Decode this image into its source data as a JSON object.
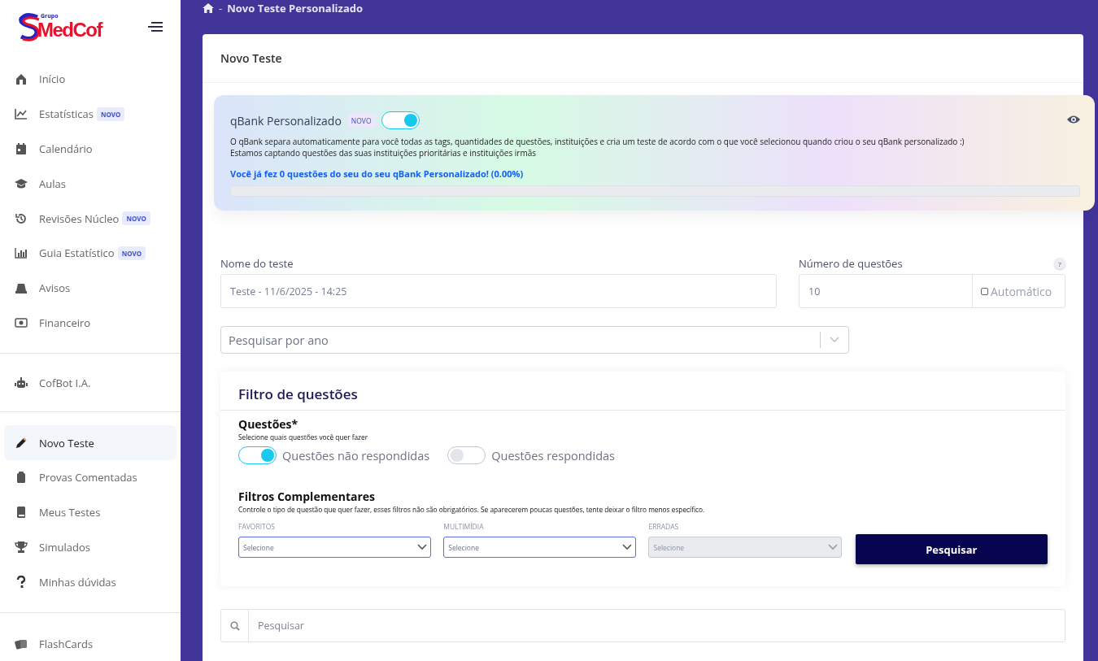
{
  "logo": {
    "prefix": "Grupo",
    "name": "MedCof"
  },
  "sidebar": {
    "groups": [
      [
        {
          "label": "Início",
          "selected": false
        },
        {
          "label": "Estatísticas",
          "badge": "NOVO",
          "selected": false
        },
        {
          "label": "Calendário",
          "selected": false
        },
        {
          "label": "Aulas",
          "selected": false
        },
        {
          "label": "Revisões Núcleo",
          "badge": "NOVO",
          "selected": false
        },
        {
          "label": "Guia Estatístico",
          "badge": "NOVO",
          "selected": false
        },
        {
          "label": "Avisos",
          "selected": false
        },
        {
          "label": "Financeiro",
          "selected": false
        }
      ],
      [
        {
          "label": "CofBot I.A.",
          "selected": false
        }
      ],
      [
        {
          "label": "Novo Teste",
          "selected": true
        },
        {
          "label": "Provas Comentadas",
          "selected": false
        },
        {
          "label": "Meus Testes",
          "selected": false
        },
        {
          "label": "Simulados",
          "selected": false
        },
        {
          "label": "Minhas dúvidas",
          "selected": false
        }
      ],
      [
        {
          "label": "FlashCards",
          "selected": false
        }
      ]
    ]
  },
  "breadcrumb": {
    "separator": "-",
    "title": "Novo Teste Personalizado"
  },
  "card_title": "Novo Teste",
  "qbank": {
    "title": "qBank Personalizado",
    "badge": "NOVO",
    "on": true,
    "lines": [
      "O qBank separa automaticamente para você todas as tags, quantidades de questões, instituições e cria um teste de acordo com o que você selecionou quando criou o seu qBank personalizado :)",
      "Estamos captando questões das suas instituições prioritárias e instituições irmãs"
    ],
    "progress_text": "Você já fez 0 questões do seu do seu qBank Personalizado! (0.00%)",
    "level": 0
  },
  "form": {
    "name_label": "Nome do teste",
    "name_value": "Teste - 11/6/2025 - 14:25",
    "count_label": "Número de questões",
    "help": "?",
    "count_value": "10",
    "auto_label": "Automático",
    "auto_checked": false,
    "year_placeholder": "Pesquisar por ano"
  },
  "filter": {
    "title": "Filtro de questões",
    "questions_title": "Questões*",
    "questions_hint": "Selecione quais questões você quer fazer",
    "toggles": [
      {
        "label": "Questões não respondidas",
        "on": true
      },
      {
        "label": "Questões respondidas",
        "on": false
      }
    ],
    "extra_title": "Filtros Complementares",
    "extra_hint": "Controle o tipo de questão que quer fazer, esses filtros não são obrigatórios. Se aparecerem poucas questões, tente deixar o filtro menos específico.",
    "selects": [
      {
        "label": "FAVORITOS",
        "placeholder": "Selecione",
        "disabled": false
      },
      {
        "label": "MULTIMÍDIA",
        "placeholder": "Selecione",
        "disabled": false
      },
      {
        "label": "ERRADAS",
        "placeholder": "Selecione",
        "disabled": true
      }
    ],
    "button": "Pesquisar"
  },
  "search": {
    "placeholder": "Pesquisar"
  }
}
